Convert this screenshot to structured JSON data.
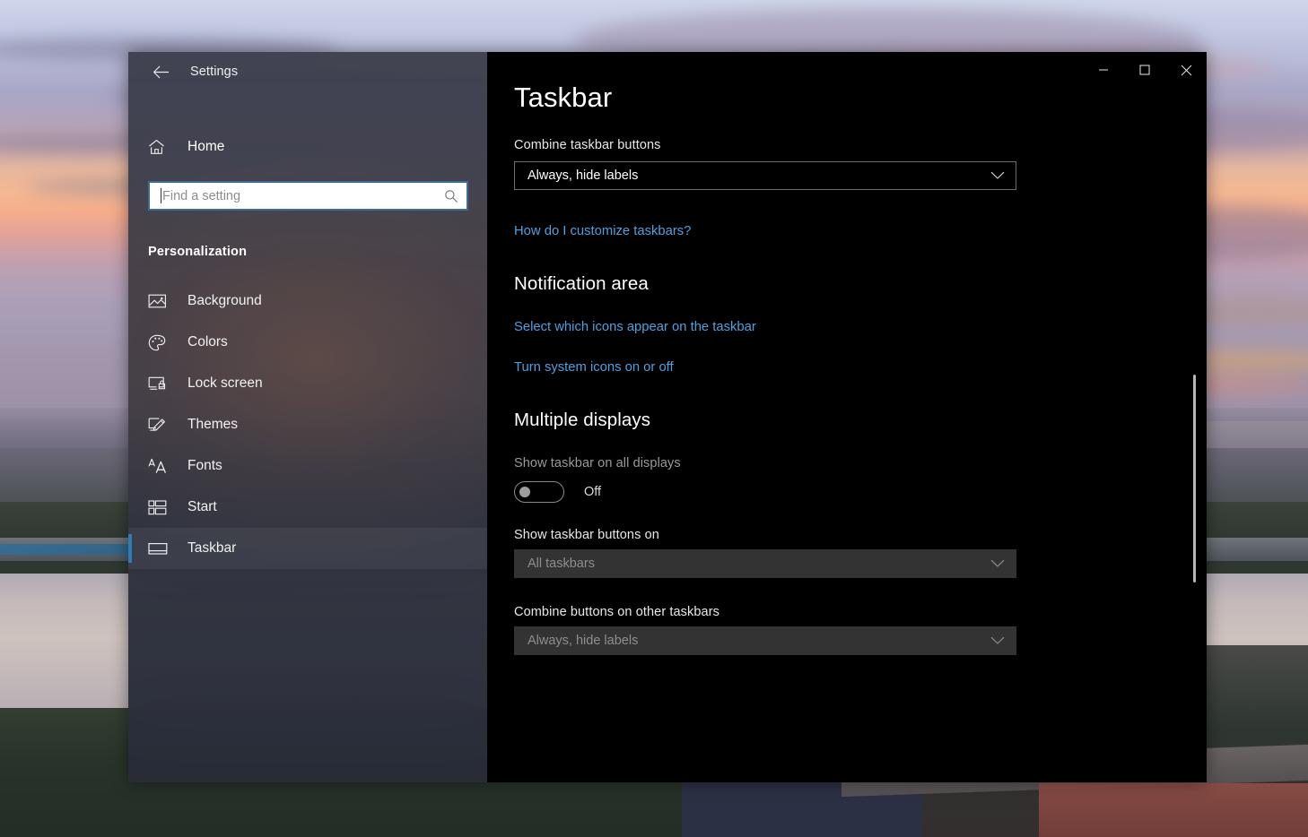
{
  "window": {
    "app_title": "Settings",
    "back_icon": "back-arrow-icon",
    "controls": {
      "minimize": "─",
      "maximize": "□",
      "close": "✕"
    }
  },
  "sidebar": {
    "home": {
      "label": "Home",
      "icon": "home-icon"
    },
    "search": {
      "placeholder": "Find a setting",
      "value": "",
      "icon": "search-icon"
    },
    "section_title": "Personalization",
    "items": [
      {
        "label": "Background",
        "icon": "image-icon",
        "selected": false
      },
      {
        "label": "Colors",
        "icon": "palette-icon",
        "selected": false
      },
      {
        "label": "Lock screen",
        "icon": "lock-screen-icon",
        "selected": false
      },
      {
        "label": "Themes",
        "icon": "brush-icon",
        "selected": false
      },
      {
        "label": "Fonts",
        "icon": "fonts-icon",
        "selected": false
      },
      {
        "label": "Start",
        "icon": "start-icon",
        "selected": false
      },
      {
        "label": "Taskbar",
        "icon": "taskbar-icon",
        "selected": true
      }
    ]
  },
  "main": {
    "page_title": "Taskbar",
    "combine_label": "Combine taskbar buttons",
    "combine_value": "Always, hide labels",
    "help_link": "How do I customize taskbars?",
    "notification_heading": "Notification area",
    "notification_links": [
      "Select which icons appear on the taskbar",
      "Turn system icons on or off"
    ],
    "multiple_displays_heading": "Multiple displays",
    "show_all_displays_label": "Show taskbar on all displays",
    "show_all_displays_state": "Off",
    "show_buttons_label": "Show taskbar buttons on",
    "show_buttons_value": "All taskbars",
    "combine_other_label": "Combine buttons on other taskbars",
    "combine_other_value": "Always, hide labels"
  },
  "colors": {
    "accent": "#2f7bb8",
    "link": "#4da0e0",
    "search_border": "#3a6d94",
    "content_bg": "#000000",
    "disabled_select_bg": "#333333"
  }
}
